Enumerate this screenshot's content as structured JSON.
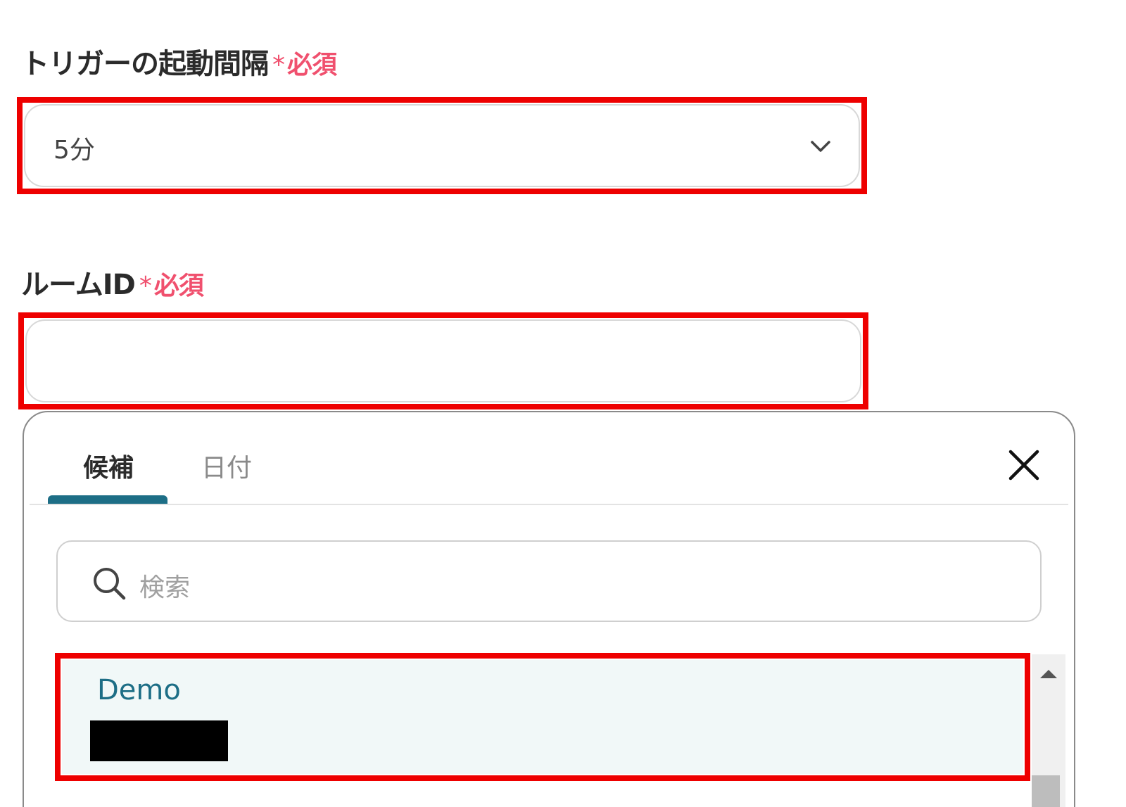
{
  "trigger_interval": {
    "label": "トリガーの起動間隔",
    "required_star": "*",
    "required_text": "必須",
    "selected_value": "5分"
  },
  "room_id": {
    "label": "ルームID",
    "required_star": "*",
    "required_text": "必須",
    "value": ""
  },
  "popover": {
    "tabs": [
      {
        "label": "候補",
        "active": true
      },
      {
        "label": "日付",
        "active": false
      }
    ],
    "search": {
      "placeholder": "検索"
    },
    "options": [
      {
        "title": "Demo"
      }
    ]
  },
  "colors": {
    "accent": "#1d6e86",
    "required": "#f0506e",
    "highlight": "#ee0000"
  },
  "icons": [
    "chevron-down-icon",
    "close-icon",
    "search-icon",
    "scroll-up-icon"
  ]
}
